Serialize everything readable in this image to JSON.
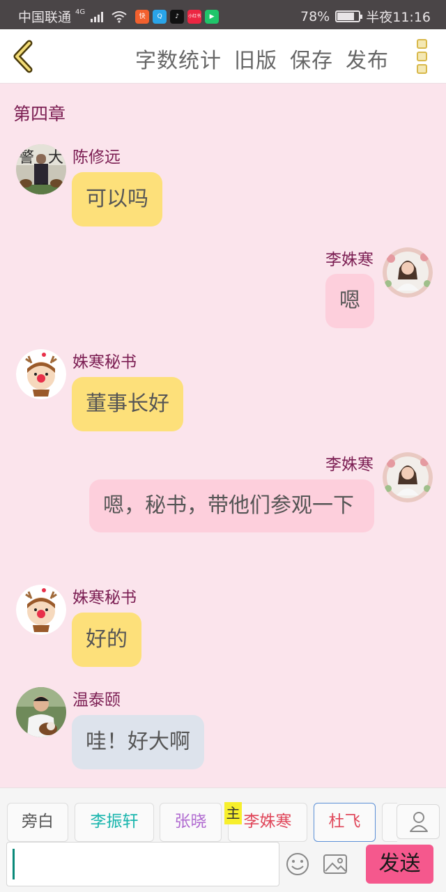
{
  "status_bar": {
    "carrier": "中国联通",
    "network": "4G",
    "battery": "78%",
    "battery_level": 0.78,
    "time": "半夜11:16",
    "apps": [
      {
        "name": "kuaishou-app-icon",
        "color": "#f2602e",
        "glyph": "快"
      },
      {
        "name": "qq-browser-app-icon",
        "color": "#2aa4e8",
        "glyph": "Q"
      },
      {
        "name": "tiktok-app-icon",
        "color": "#111111",
        "glyph": "♪"
      },
      {
        "name": "xiaohongshu-app-icon",
        "color": "#ec2642",
        "glyph": "小红书"
      },
      {
        "name": "video-app-icon",
        "color": "#1fc56a",
        "glyph": "▶"
      }
    ]
  },
  "header": {
    "actions": [
      "字数统计",
      "旧版",
      "保存",
      "发布"
    ]
  },
  "chapter_title": "第四章",
  "messages": [
    {
      "speaker": "陈修远",
      "text": "可以吗",
      "side": "left",
      "color": "yellow"
    },
    {
      "speaker": "李姝寒",
      "text": "嗯",
      "side": "right",
      "color": "pink"
    },
    {
      "speaker": "姝寒秘书",
      "text": "董事长好",
      "side": "left",
      "color": "yellow"
    },
    {
      "speaker": "李姝寒",
      "text": "嗯，秘书，带他们参观一下",
      "side": "right",
      "color": "pink"
    },
    {
      "speaker": "姝寒秘书",
      "text": "好的",
      "side": "left",
      "color": "yellow"
    },
    {
      "speaker": "温泰颐",
      "text": "哇！好大啊",
      "side": "left",
      "color": "gray"
    }
  ],
  "roles": [
    {
      "label": "旁白",
      "color": "#555555"
    },
    {
      "label": "李振轩",
      "color": "#19b5ad"
    },
    {
      "label": "张晓",
      "color": "#b06ad0"
    },
    {
      "label": "李姝寒",
      "color": "#e0475a"
    },
    {
      "label": "杜飞",
      "color": "#e0475a"
    }
  ],
  "role_badge": "主",
  "input": {
    "value": ""
  },
  "send_label": "发送",
  "colors": {
    "accent": "#f5588d",
    "background": "#fbe4ec",
    "name": "#7b1d52"
  }
}
